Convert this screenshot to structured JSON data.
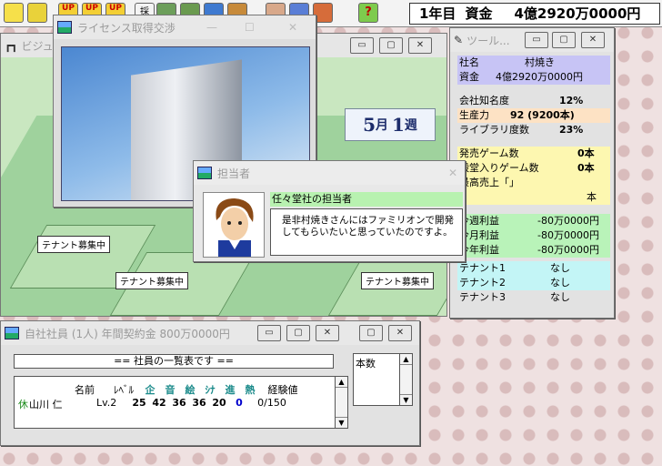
{
  "status": {
    "year": "1年目",
    "funds_label": "資金",
    "funds_value": "4億2920万0000円"
  },
  "toolbar": {
    "icons": [
      "building-icon",
      "building2-icon",
      "up-icon",
      "up2-icon",
      "up3-icon",
      "hire-icon",
      "office-icon",
      "monitor-icon",
      "ranking-icon",
      "shop-icon",
      "person-icon",
      "chart-icon",
      "ranking2-icon",
      "help-icon"
    ],
    "labels": [
      "UP",
      "UP",
      "UP",
      "採"
    ]
  },
  "city": {
    "title": "ビジュ",
    "week": {
      "month": "5",
      "month_unit": "月",
      "week": "1",
      "week_unit": "週"
    },
    "tenants": [
      "テナント募集中",
      "テナント募集中",
      "テナント募集中"
    ]
  },
  "license": {
    "title": "ライセンス取得交渉"
  },
  "dialog": {
    "title": "担当者",
    "speaker": "任々堂社の担当者",
    "message": "是非村焼きさんにはファミリオンで開発してもらいたいと思っていたのですよ。"
  },
  "info": {
    "title": "ツール...",
    "company_label": "社名",
    "company_value": "村焼き",
    "funds_label": "資金",
    "funds_value": "4億2920万0000円",
    "fame_label": "会社知名度",
    "fame_value": "12%",
    "prod_label": "生産力",
    "prod_value": "92 (9200本)",
    "library_label": "ライブラリ度数",
    "library_value": "23%",
    "released_label": "発売ゲーム数",
    "released_value": "0本",
    "hall_label": "殿堂入りゲーム数",
    "hall_value": "0本",
    "best_label": "最高売上「」",
    "best_value": "本",
    "weekly_label": "今週利益",
    "weekly_value": "-80万0000円",
    "monthly_label": "今月利益",
    "monthly_value": "-80万0000円",
    "yearly_label": "今年利益",
    "yearly_value": "-80万0000円",
    "tenant1_label": "テナント1",
    "tenant1_value": "なし",
    "tenant2_label": "テナント2",
    "tenant2_value": "なし",
    "tenant3_label": "テナント3",
    "tenant3_value": "なし"
  },
  "employees": {
    "title": "自社社員 (1人) 年間契約金 800万0000円",
    "header_bar": "== 社員の一覧表です ==",
    "columns": [
      "名前",
      "ﾚﾍﾞﾙ",
      "企",
      "音",
      "絵",
      "ｼﾅ",
      "進",
      "熱",
      "経験値"
    ],
    "row": {
      "status": "休",
      "name": "山川 仁",
      "level": "Lv.2",
      "stats": [
        "25",
        "42",
        "36",
        "36",
        "20",
        "0"
      ],
      "exp": "0/150"
    },
    "side_label": "本数"
  },
  "colors": {
    "week_text": "#1c2c6b",
    "zero_stat": "#0000cc"
  }
}
